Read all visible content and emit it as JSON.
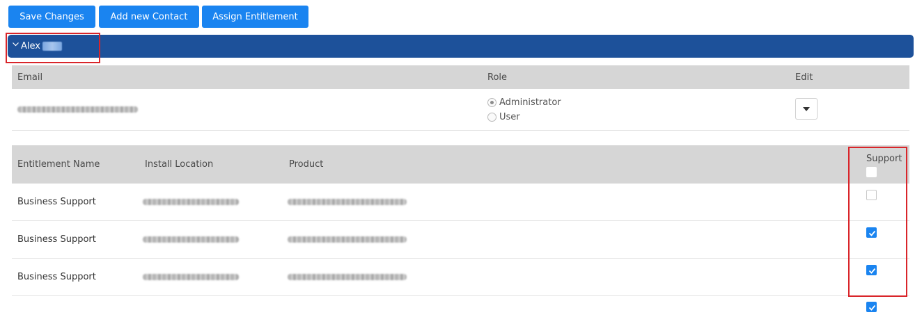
{
  "toolbar": {
    "save_label": "Save Changes",
    "add_contact_label": "Add new Contact",
    "assign_entitlement_label": "Assign Entitlement"
  },
  "contact": {
    "first_name": "Alex",
    "expanded": true
  },
  "contact_table": {
    "headers": {
      "email": "Email",
      "role": "Role",
      "edit": "Edit"
    },
    "role_options": [
      "Administrator",
      "User"
    ],
    "selected_role": "Administrator"
  },
  "entitlements_table": {
    "headers": {
      "name": "Entitlement Name",
      "location": "Install Location",
      "product": "Product",
      "support": "Support"
    },
    "rows": [
      {
        "name": "Business Support",
        "support_checked": false
      },
      {
        "name": "Business Support",
        "support_checked": true
      },
      {
        "name": "Business Support",
        "support_checked": true
      },
      {
        "name": "",
        "support_checked": true
      }
    ]
  },
  "colors": {
    "button_bg": "#1a84f0",
    "contact_bar_bg": "#1d519a",
    "header_bg": "#d6d6d6",
    "highlight_border": "#d9252a"
  }
}
